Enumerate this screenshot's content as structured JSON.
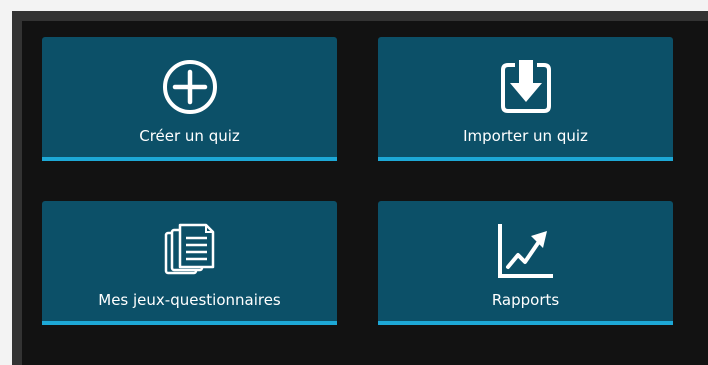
{
  "colors": {
    "tile_background": "#0c5068",
    "tile_accent": "#1da8d6",
    "panel_background": "#121212",
    "frame_border": "#333333"
  },
  "tiles": [
    {
      "label": "Créer un quiz",
      "icon": "plus-circle-icon"
    },
    {
      "label": "Importer un quiz",
      "icon": "import-download-icon"
    },
    {
      "label": "Mes jeux-questionnaires",
      "icon": "documents-stack-icon"
    },
    {
      "label": "Rapports",
      "icon": "trend-chart-icon"
    }
  ]
}
